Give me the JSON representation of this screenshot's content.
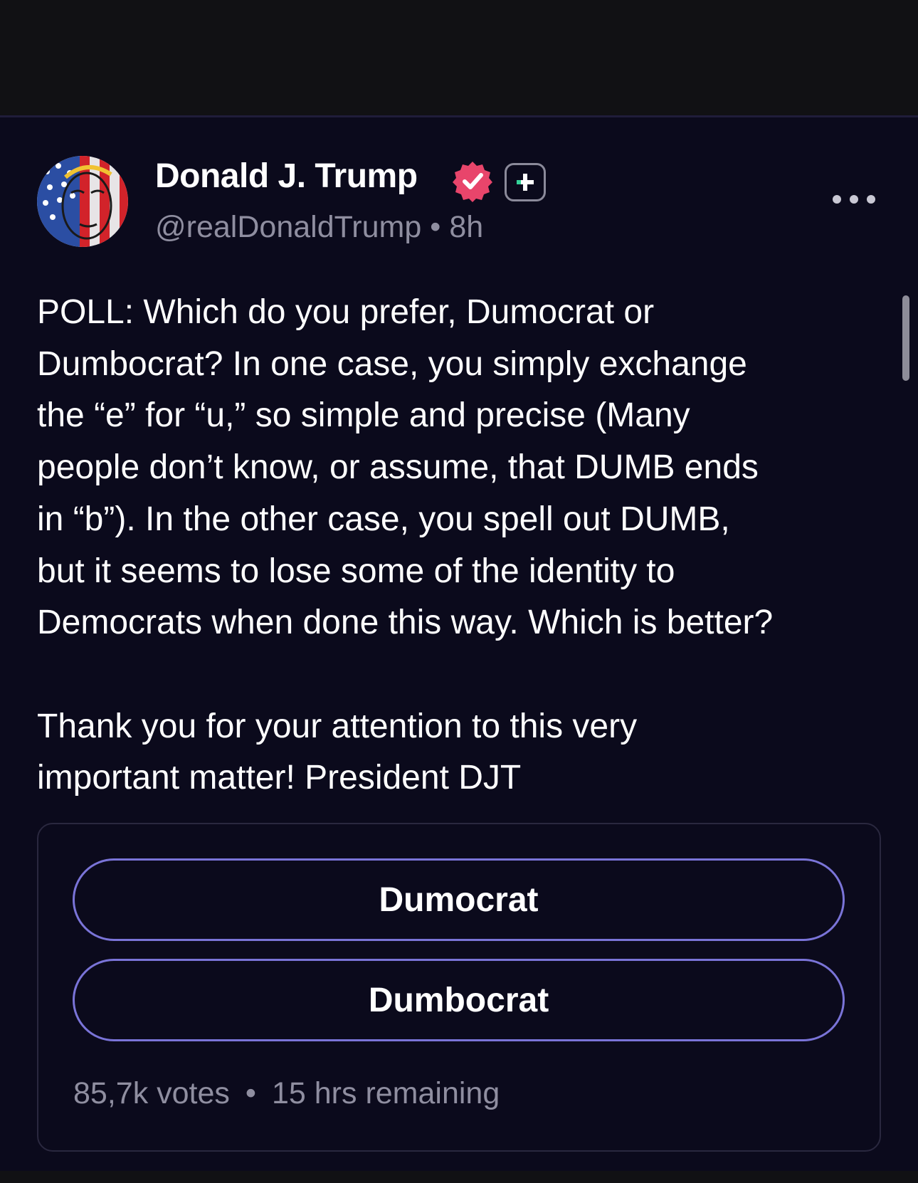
{
  "post": {
    "author_name": "Donald J. Trump",
    "handle": "@realDonaldTrump",
    "separator": "•",
    "time_ago": "8h",
    "text": "POLL: Which do you prefer, Dumocrat or\nDumbocrat? In one case, you simply exchange\nthe “e” for “u,” so simple and precise (Many\npeople don’t know, or assume, that DUMB ends\nin “b”). In the other case, you spell out DUMB,\nbut it seems to lose some of the identity to\nDemocrats when done this way. Which is better?\n\nThank you for your attention to this very\nimportant matter! President DJT",
    "icons": {
      "verified": "verified-badge-icon",
      "plus": "plus-subscription-icon",
      "more": "more-options-icon"
    }
  },
  "poll": {
    "options": [
      "Dumocrat",
      "Dumbocrat"
    ],
    "votes": "85,7k votes",
    "separator": "•",
    "remaining": "15 hrs remaining"
  },
  "colors": {
    "background": "#0b0a1c",
    "option_border": "#7a74d8",
    "verified": "#e8456b",
    "muted_text": "#8f8ea0"
  }
}
